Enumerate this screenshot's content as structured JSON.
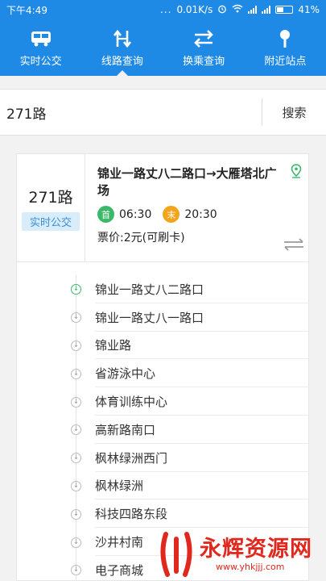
{
  "status_bar": {
    "time": "下午4:49",
    "dots": "...",
    "speed": "0.01K/s",
    "battery": "41%"
  },
  "nav": {
    "items": [
      {
        "label": "实时公交",
        "icon": "bus-icon",
        "active": false
      },
      {
        "label": "线路查询",
        "icon": "route-icon",
        "active": true
      },
      {
        "label": "换乘查询",
        "icon": "transfer-icon",
        "active": false
      },
      {
        "label": "附近站点",
        "icon": "nearby-stop-icon",
        "active": false
      }
    ]
  },
  "search": {
    "value": "271路",
    "button_label": "搜索"
  },
  "route": {
    "number": "271路",
    "tag": "实时公交",
    "direction": "锦业一路丈八二路口→大雁塔北广场",
    "first_badge": "首",
    "first_time": "06:30",
    "last_badge": "末",
    "last_time": "20:30",
    "fare": "票价:2元(可刷卡)"
  },
  "stops": [
    "锦业一路丈八二路口",
    "锦业一路丈八一路口",
    "锦业路",
    "省游泳中心",
    "体育训练中心",
    "高新路南口",
    "枫林绿洲西门",
    "枫林绿洲",
    "科技四路东段",
    "沙井村南",
    "电子商城"
  ],
  "watermark": {
    "title": "永辉资源网",
    "url": "www.yhkjjj.com"
  },
  "colors": {
    "primary": "#1e8ae6",
    "first_badge": "#3cb86a",
    "last_badge": "#f2a51b",
    "tag_bg": "#d9ecfb",
    "watermark": "#e0281f"
  }
}
